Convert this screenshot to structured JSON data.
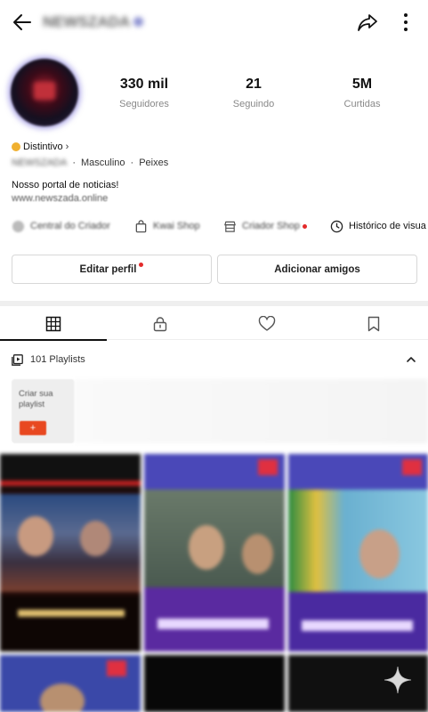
{
  "topbar": {
    "username": "NEWSZADA",
    "back_icon": "arrow-left-icon",
    "share_icon": "share-icon",
    "more_icon": "more-vertical-icon"
  },
  "profile": {
    "avatar_icon": "avatar",
    "stats": [
      {
        "value": "330 mil",
        "label": "Seguidores"
      },
      {
        "value": "21",
        "label": "Seguindo"
      },
      {
        "value": "5M",
        "label": "Curtidas"
      }
    ],
    "badge_label": "Distintivo",
    "badge_chevron": "›",
    "name_blurred": "NEWSZADA",
    "gender": "Masculino",
    "sign": "Peixes",
    "separator": "·",
    "bio": "Nosso portal de noticias!",
    "website": "www.newszada.online"
  },
  "quick_links": [
    {
      "label": "Central do Criador",
      "icon": "creator-center-icon"
    },
    {
      "label": "Kwai Shop",
      "icon": "shopping-bag-icon"
    },
    {
      "label": "Criador Shop",
      "icon": "storefront-icon"
    },
    {
      "label": "Histórico de visua",
      "icon": "clock-history-icon"
    }
  ],
  "buttons": {
    "edit_profile": "Editar perfil",
    "add_friends": "Adicionar amigos"
  },
  "tabs": [
    {
      "name": "grid",
      "icon": "grid-icon",
      "active": true
    },
    {
      "name": "private",
      "icon": "lock-icon",
      "active": false
    },
    {
      "name": "likes",
      "icon": "heart-icon",
      "active": false
    },
    {
      "name": "saved",
      "icon": "bookmark-icon",
      "active": false
    }
  ],
  "playlists": {
    "label": "101 Playlists",
    "create_label": "Criar sua playlist",
    "create_button": "+"
  },
  "colors": {
    "accent_red": "#e32b2b",
    "badge_gold": "#f0b030",
    "create_orange": "#e84820"
  },
  "floating_icon": "sparkle-icon"
}
